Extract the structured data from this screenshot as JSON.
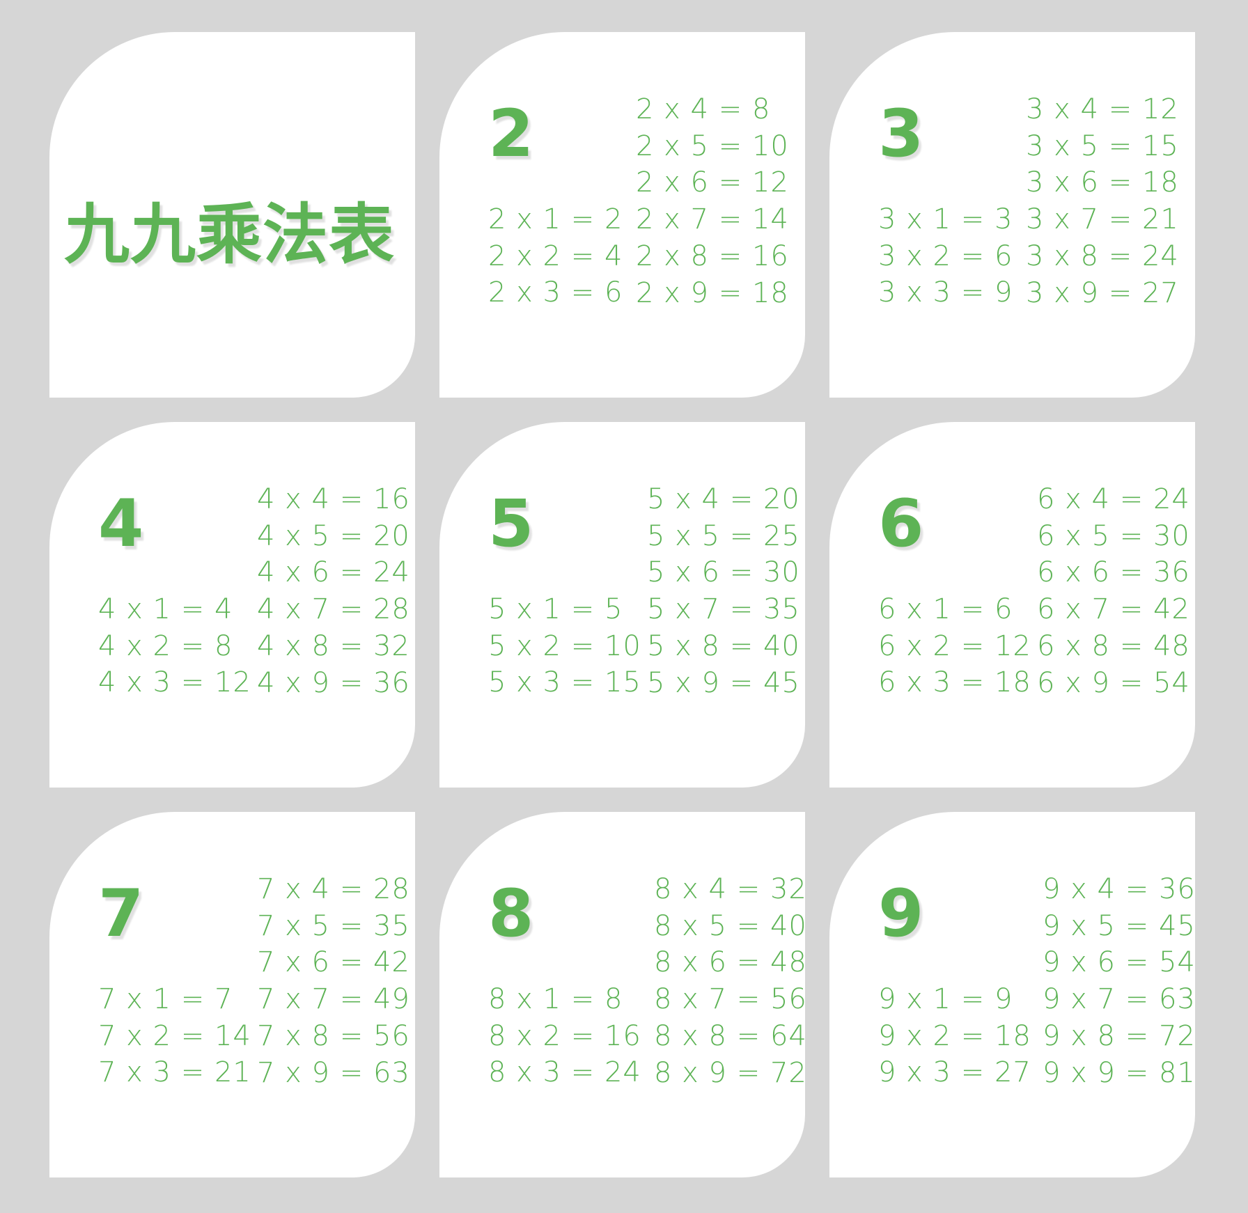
{
  "title": "九九乘法表",
  "accent_color": "#5db355",
  "background_color": "#d6d6d6",
  "card_color": "#ffffff",
  "tables": [
    {
      "number": "2",
      "left": [
        "2 x 1 = 2",
        "2 x 2 = 4",
        "2 x 3 = 6"
      ],
      "right": [
        "2 x 4 = 8",
        "2 x 5 = 10",
        "2 x 6 = 12",
        "2 x 7 = 14",
        "2 x 8 = 16",
        "2 x 9 = 18"
      ]
    },
    {
      "number": "3",
      "left": [
        "3 x 1 = 3",
        "3 x 2 = 6",
        "3 x 3 = 9"
      ],
      "right": [
        "3 x 4 = 12",
        "3 x 5 = 15",
        "3 x 6 = 18",
        "3 x 7 = 21",
        "3 x 8 = 24",
        "3 x 9 = 27"
      ]
    },
    {
      "number": "4",
      "left": [
        "4 x 1 = 4",
        "4 x 2 = 8",
        "4 x 3 = 12"
      ],
      "right": [
        "4 x 4 = 16",
        "4 x 5 = 20",
        "4 x 6 = 24",
        "4 x 7 = 28",
        "4 x 8 = 32",
        "4 x 9 = 36"
      ]
    },
    {
      "number": "5",
      "left": [
        "5 x 1 = 5",
        "5 x 2 = 10",
        "5 x 3 = 15"
      ],
      "right": [
        "5 x 4 = 20",
        "5 x 5 = 25",
        "5 x 6 = 30",
        "5 x 7 = 35",
        "5 x 8 = 40",
        "5 x 9 = 45"
      ]
    },
    {
      "number": "6",
      "left": [
        "6 x 1 = 6",
        "6 x 2 = 12",
        "6 x 3 = 18"
      ],
      "right": [
        "6 x 4 = 24",
        "6 x 5 = 30",
        "6 x 6 = 36",
        "6 x 7 = 42",
        "6 x 8 = 48",
        "6 x 9 = 54"
      ]
    },
    {
      "number": "7",
      "left": [
        "7 x 1 = 7",
        "7 x 2 = 14",
        "7 x 3 = 21"
      ],
      "right": [
        "7 x 4 = 28",
        "7 x 5 = 35",
        "7 x 6 = 42",
        "7 x 7 = 49",
        "7 x 8 = 56",
        "7 x 9 = 63"
      ]
    },
    {
      "number": "8",
      "left": [
        "8 x 1 = 8",
        "8 x 2 = 16",
        "8 x 3 = 24"
      ],
      "right": [
        "8 x 4 = 32",
        "8 x 5 = 40",
        "8 x 6 = 48",
        "8 x 7 = 56",
        "8 x 8 = 64",
        "8 x 9 = 72"
      ]
    },
    {
      "number": "9",
      "left": [
        "9 x 1 = 9",
        "9 x 2 = 18",
        "9 x 3 = 27"
      ],
      "right": [
        "9 x 4 = 36",
        "9 x 5 = 45",
        "9 x 6 = 54",
        "9 x 7 = 63",
        "9 x 8 = 72",
        "9 x 9 = 81"
      ]
    }
  ]
}
